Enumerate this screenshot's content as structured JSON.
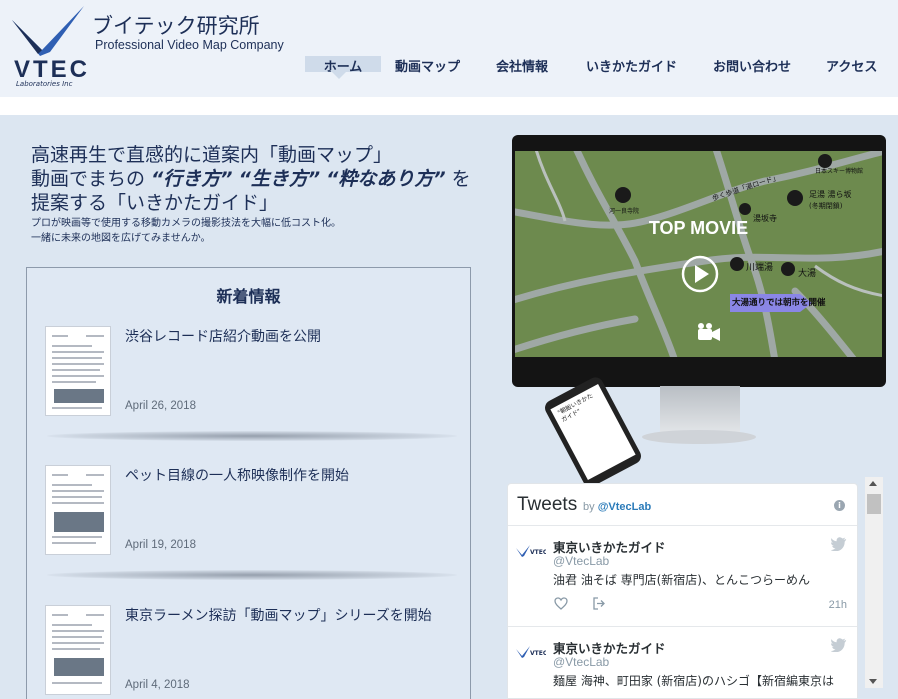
{
  "brand": {
    "logo_word": "VTEC",
    "logo_sub": "Laboratories Inc",
    "name_jp": "ブイテック研究所",
    "tagline": "Professional Video Map Company",
    "color": "#1d2f57",
    "accent": "#2f5fb3"
  },
  "nav": {
    "items": [
      {
        "label": "ホーム",
        "active": true
      },
      {
        "label": "動画マップ"
      },
      {
        "label": "会社情報"
      },
      {
        "label": "いきかたガイド"
      },
      {
        "label": "お問い合わせ"
      },
      {
        "label": "アクセス"
      }
    ]
  },
  "hero": {
    "line1": "高速再生で直感的に道案内「動画マップ」",
    "line2_pre": "動画でまちの ",
    "line2_b1": "“行き方”",
    "line2_b2": "“生き方”",
    "line2_b3": "“粋なあり方”",
    "line2_post": " を",
    "line3": "提案する「いきかたガイド」",
    "sub1": "プロが映画等で使用する移動カメラの撮影技法を大幅に低コスト化。",
    "sub2": "一緒に未来の地図を広げてみませんか。"
  },
  "news": {
    "title": "新着情報",
    "items": [
      {
        "title": "渋谷レコード店紹介動画を公開",
        "date": "April 26, 2018"
      },
      {
        "title": "ペット目線の一人称映像制作を開始",
        "date": "April 19, 2018"
      },
      {
        "title": "東京ラーメン探訪「動画マップ」シリーズを開始",
        "date": "April 4, 2018"
      }
    ]
  },
  "movie": {
    "label": "TOP MOVIE",
    "play_icon": "play-icon",
    "map_labels": {
      "ski": "日本スキー博物館",
      "temple": "河一良寺院",
      "street": "歩く歩道「湯ロード」",
      "inn": "湯坂寺",
      "onsen_name": "足湯 湯ら坂",
      "onsen_sub": "(冬期閉鎖)",
      "kawa": "川端湯",
      "oyu": "大湯",
      "banner": "大湯通りでは朝市を開催"
    },
    "phone_text": "\"朝飯いきかたガイド\""
  },
  "tweets": {
    "title": "Tweets",
    "by": "by",
    "handle_link": "@VtecLab",
    "items": [
      {
        "name": "東京いきかたガイド",
        "handle": "@VtecLab",
        "text": "油君 油そば 専門店(新宿店)、とんこつらーめん",
        "time": "21h"
      },
      {
        "name": "東京いきかたガイド",
        "handle": "@VtecLab",
        "text": "麺屋 海神、町田家 (新宿店)のハシゴ【新宿編東京は",
        "time": ""
      }
    ]
  }
}
